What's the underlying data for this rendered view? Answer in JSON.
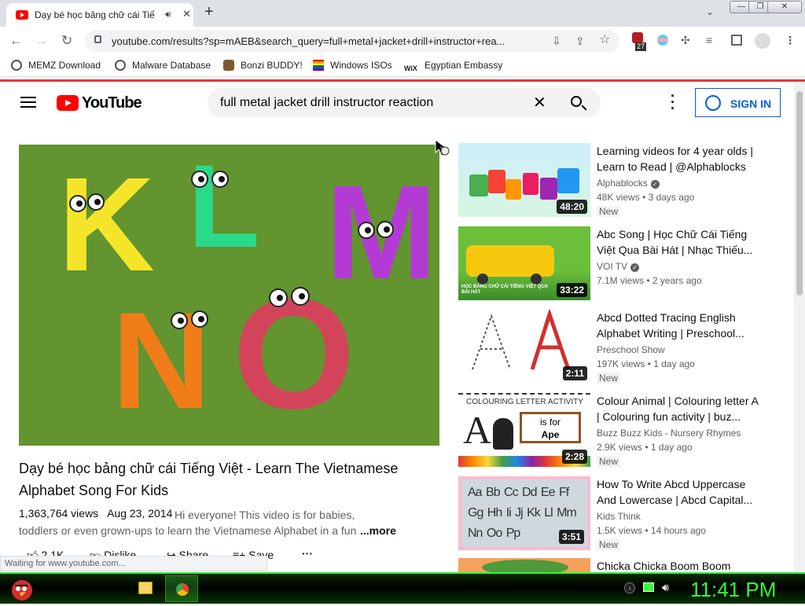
{
  "browser": {
    "tab_title": "Dạy bé học bảng chữ cái Tiế",
    "url": "youtube.com/results?sp=mAEB&search_query=full+metal+jacket+drill+instructor+rea...",
    "extension_badge": "27",
    "status_text": "Waiting for www.youtube.com..."
  },
  "bookmarks": [
    {
      "label": "MEMZ Download",
      "color": "#555555"
    },
    {
      "label": "Malware Database",
      "color": "#555555"
    },
    {
      "label": "Bonzi BUDDY!",
      "color": "#7b2fbe"
    },
    {
      "label": "Windows ISOs",
      "color": "#e91e63"
    },
    {
      "label": "Egyptian Embassy",
      "color": "#222222"
    }
  ],
  "youtube": {
    "logo_text": "YouTube",
    "search_query": "full metal jacket drill instructor reaction",
    "sign_in_label": "SIGN IN"
  },
  "main_video": {
    "title": "Dạy bé học bảng chữ cái Tiếng Việt - Learn The Vietnamese Alphabet Song For Kids",
    "views": "1,363,764 views",
    "date": "Aug 23, 2014",
    "description": "Hi everyone! This video is for babies, toddlers or even grown-ups to learn the Vietnamese Alphabet in a fun and enjo...",
    "more_label": "...more",
    "thumb_letters": [
      "K",
      "L",
      "M",
      "N",
      "O"
    ],
    "actions": {
      "likes": "2.1K",
      "dislike": "Dislike",
      "share": "Share",
      "save": "Save"
    }
  },
  "suggestions": [
    {
      "title": "Learning videos for 4 year olds | Learn to Read | @Alphablocks",
      "channel": "Alphablocks",
      "verified": true,
      "views": "48K views",
      "age": "3 days ago",
      "badge": "New",
      "duration": "48:20"
    },
    {
      "title": "Abc Song | Học Chữ Cái Tiếng Việt Qua Bài Hát | Nhạc Thiếu...",
      "channel": "VOI TV",
      "verified": true,
      "views": "7.1M views",
      "age": "2 years ago",
      "badge": "",
      "duration": "33:22",
      "thumb_caption": "HỌC BẢNG CHỮ CÁI TIẾNG VIỆT QUA BÀI HÁT"
    },
    {
      "title": "Abcd Dotted Tracing English Alphabet Writing | Preschool...",
      "channel": "Preschool Show",
      "verified": false,
      "views": "197K views",
      "age": "1 day ago",
      "badge": "New",
      "duration": "2:11"
    },
    {
      "title": "Colour Animal | Colouring letter A | Colouring fun activity | buz...",
      "channel": "Buzz Buzz Kids - Nursery Rhymes",
      "verified": false,
      "views": "2.9K views",
      "age": "1 day ago",
      "badge": "New",
      "duration": "2:28",
      "thumb_heading": "COLOURING LETTER ACTIVITY",
      "thumb_sign_line1": "is for",
      "thumb_sign_line2": "Ape"
    },
    {
      "title": "How To Write Abcd Uppercase And Lowercase | Abcd Capital...",
      "channel": "Kids Think",
      "verified": false,
      "views": "1.5K views",
      "age": "14 hours ago",
      "badge": "New",
      "duration": "3:51",
      "thumb_text": "Aa Bb Cc Dd Ee Ff Gg Hh Ii Jj Kk Ll Mm Nn Oo Pp"
    },
    {
      "title": "Chicka Chicka Boom Boom",
      "channel": "",
      "verified": false,
      "views": "",
      "age": "",
      "badge": "",
      "duration": ""
    }
  ],
  "taskbar": {
    "clock": "11:41 PM"
  }
}
